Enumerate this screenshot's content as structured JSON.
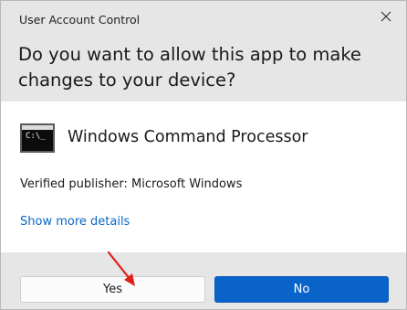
{
  "window": {
    "title": "User Account Control",
    "close_icon": "close-icon"
  },
  "prompt": {
    "question": "Do you want to allow this app to make changes to your device?"
  },
  "app": {
    "icon": "command-prompt-icon",
    "icon_text": "C:\\_",
    "name": "Windows Command Processor",
    "publisher": "Verified publisher: Microsoft Windows",
    "details_link": "Show more details"
  },
  "buttons": {
    "yes_label": "Yes",
    "no_label": "No"
  },
  "annotation": {
    "arrow_color": "#e0201a"
  },
  "colors": {
    "accent": "#0a63c9",
    "link": "#0a67c4",
    "header_bg": "#e6e6e6"
  }
}
